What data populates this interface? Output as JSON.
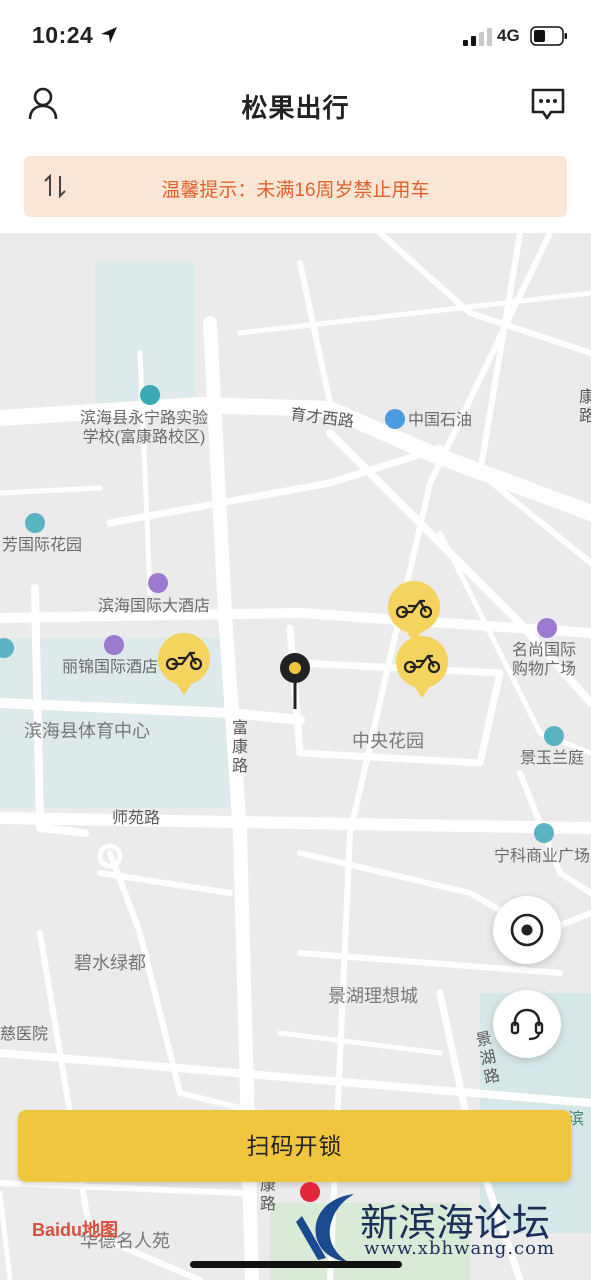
{
  "status_bar": {
    "time": "10:24",
    "network": "4G"
  },
  "header": {
    "title": "松果出行",
    "user_icon": "user-icon",
    "message_icon": "message-icon"
  },
  "notice": {
    "text": "温馨提示：未满16周岁禁止用车",
    "icon": "sort-arrows-icon"
  },
  "map": {
    "labels": {
      "school": "滨海县永宁路实验\n学校(富康路校区)",
      "yucai_road": "育才西路",
      "sinopec": "中国石油",
      "fang_garden": "芳国际花园",
      "hotel_binhai": "滨海国际大酒店",
      "hotel_lijin": "丽锦国际酒店",
      "mingshang": "名尚国际\n购物广场",
      "sports_center": "滨海县体育中心",
      "fukang_road": "富康路",
      "zhongyang_garden": "中央花园",
      "jingyu": "景玉兰庭",
      "shiyuan_road": "师苑路",
      "ningke": "宁科商业广场",
      "bishui": "碧水绿都",
      "jinghu_city": "景湖理想城",
      "hospital": "慈医院",
      "jinghu_road": "景湖路",
      "fukang_road_2": "康路",
      "dexin": "华德名人苑",
      "right_edge_road": "康路",
      "binhai_edge": "滨"
    },
    "bike_icon": "bike-icon",
    "center_pin_icon": "location-pin-icon"
  },
  "controls": {
    "locate_icon": "locate-target-icon",
    "support_icon": "headset-icon"
  },
  "scan_button": {
    "label": "扫码开锁"
  },
  "map_logo": {
    "text": "Baidu地图"
  },
  "watermark": {
    "title": "新滨海论坛",
    "url": "www.xbhwang.com"
  },
  "colors": {
    "accent": "#f0c63e",
    "notice_bg": "#fbe5d5",
    "notice_text": "#e0622c",
    "bike_marker": "#f4d35e"
  }
}
